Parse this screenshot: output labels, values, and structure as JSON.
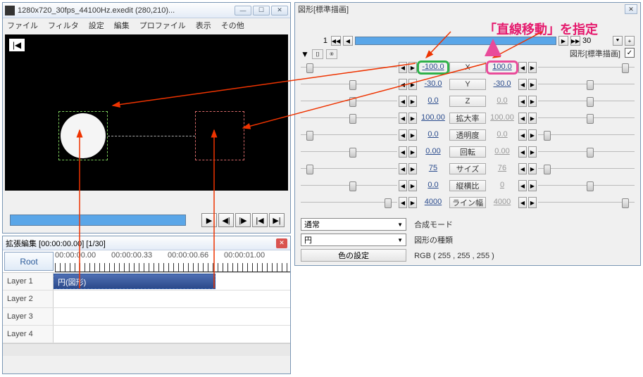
{
  "preview_win": {
    "title": "1280x720_30fps_44100Hz.exedit (280,210)...",
    "menu": [
      "ファイル",
      "フィルタ",
      "設定",
      "編集",
      "プロファイル",
      "表示",
      "その他"
    ],
    "play_buttons": [
      "▶",
      "◀|",
      "|▶",
      "|◀",
      "▶|"
    ]
  },
  "timeline": {
    "title": "拡張編集 [00:00:00.00] [1/30]",
    "root": "Root",
    "times": [
      "00:00:00.00",
      "00:00:00.33",
      "00:00:00.66",
      "00:00:01.00"
    ],
    "layers": [
      "Layer 1",
      "Layer 2",
      "Layer 3",
      "Layer 4"
    ],
    "clip": "円(図形)"
  },
  "prop": {
    "title": "図形[標準描画]",
    "annotation": "「直線移動」を指定",
    "frame_start": "1",
    "frame_end": "30",
    "mode_label": "図形[標準描画]",
    "params": [
      {
        "name": "X",
        "l": "-100.0",
        "r": "100.0",
        "sld_l": "left",
        "sld_r": "right",
        "hl": "both"
      },
      {
        "name": "Y",
        "l": "-30.0",
        "r": "-30.0",
        "sld_l": "mid",
        "sld_r": "mid",
        "hl": "none"
      },
      {
        "name": "Z",
        "l": "0.0",
        "r": "0.0",
        "sld_l": "mid",
        "sld_r": "mid",
        "r_dis": true
      },
      {
        "name": "拡大率",
        "l": "100.00",
        "r": "100.00",
        "sld_l": "mid",
        "sld_r": "mid",
        "r_dis": true
      },
      {
        "name": "透明度",
        "l": "0.0",
        "r": "0.0",
        "sld_l": "left",
        "sld_r": "left",
        "r_dis": true
      },
      {
        "name": "回転",
        "l": "0.00",
        "r": "0.00",
        "sld_l": "mid",
        "sld_r": "mid",
        "r_dis": true
      },
      {
        "name": "サイズ",
        "l": "75",
        "r": "76",
        "sld_l": "left",
        "sld_r": "left",
        "r_dis": true
      },
      {
        "name": "縦横比",
        "l": "0.0",
        "r": "0",
        "sld_l": "mid",
        "sld_r": "mid",
        "r_dis": true
      },
      {
        "name": "ライン幅",
        "l": "4000",
        "r": "4000",
        "sld_l": "right",
        "sld_r": "right",
        "r_dis": true
      }
    ],
    "blend_sel": "通常",
    "blend_lbl": "合成モード",
    "shape_sel": "円",
    "shape_lbl": "図形の種類",
    "color_btn": "色の設定",
    "color_val": "RGB ( 255 , 255 , 255 )"
  }
}
